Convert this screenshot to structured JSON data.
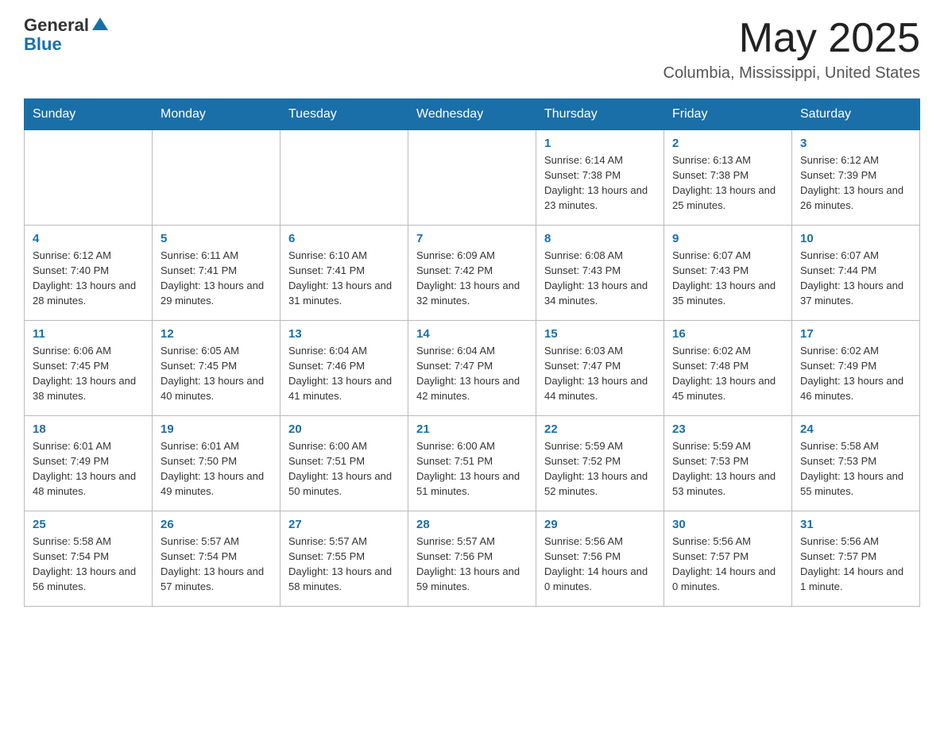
{
  "header": {
    "logo_general": "General",
    "logo_blue": "Blue",
    "month_title": "May 2025",
    "location": "Columbia, Mississippi, United States"
  },
  "weekdays": [
    "Sunday",
    "Monday",
    "Tuesday",
    "Wednesday",
    "Thursday",
    "Friday",
    "Saturday"
  ],
  "weeks": [
    [
      {
        "day": "",
        "info": ""
      },
      {
        "day": "",
        "info": ""
      },
      {
        "day": "",
        "info": ""
      },
      {
        "day": "",
        "info": ""
      },
      {
        "day": "1",
        "info": "Sunrise: 6:14 AM\nSunset: 7:38 PM\nDaylight: 13 hours and 23 minutes."
      },
      {
        "day": "2",
        "info": "Sunrise: 6:13 AM\nSunset: 7:38 PM\nDaylight: 13 hours and 25 minutes."
      },
      {
        "day": "3",
        "info": "Sunrise: 6:12 AM\nSunset: 7:39 PM\nDaylight: 13 hours and 26 minutes."
      }
    ],
    [
      {
        "day": "4",
        "info": "Sunrise: 6:12 AM\nSunset: 7:40 PM\nDaylight: 13 hours and 28 minutes."
      },
      {
        "day": "5",
        "info": "Sunrise: 6:11 AM\nSunset: 7:41 PM\nDaylight: 13 hours and 29 minutes."
      },
      {
        "day": "6",
        "info": "Sunrise: 6:10 AM\nSunset: 7:41 PM\nDaylight: 13 hours and 31 minutes."
      },
      {
        "day": "7",
        "info": "Sunrise: 6:09 AM\nSunset: 7:42 PM\nDaylight: 13 hours and 32 minutes."
      },
      {
        "day": "8",
        "info": "Sunrise: 6:08 AM\nSunset: 7:43 PM\nDaylight: 13 hours and 34 minutes."
      },
      {
        "day": "9",
        "info": "Sunrise: 6:07 AM\nSunset: 7:43 PM\nDaylight: 13 hours and 35 minutes."
      },
      {
        "day": "10",
        "info": "Sunrise: 6:07 AM\nSunset: 7:44 PM\nDaylight: 13 hours and 37 minutes."
      }
    ],
    [
      {
        "day": "11",
        "info": "Sunrise: 6:06 AM\nSunset: 7:45 PM\nDaylight: 13 hours and 38 minutes."
      },
      {
        "day": "12",
        "info": "Sunrise: 6:05 AM\nSunset: 7:45 PM\nDaylight: 13 hours and 40 minutes."
      },
      {
        "day": "13",
        "info": "Sunrise: 6:04 AM\nSunset: 7:46 PM\nDaylight: 13 hours and 41 minutes."
      },
      {
        "day": "14",
        "info": "Sunrise: 6:04 AM\nSunset: 7:47 PM\nDaylight: 13 hours and 42 minutes."
      },
      {
        "day": "15",
        "info": "Sunrise: 6:03 AM\nSunset: 7:47 PM\nDaylight: 13 hours and 44 minutes."
      },
      {
        "day": "16",
        "info": "Sunrise: 6:02 AM\nSunset: 7:48 PM\nDaylight: 13 hours and 45 minutes."
      },
      {
        "day": "17",
        "info": "Sunrise: 6:02 AM\nSunset: 7:49 PM\nDaylight: 13 hours and 46 minutes."
      }
    ],
    [
      {
        "day": "18",
        "info": "Sunrise: 6:01 AM\nSunset: 7:49 PM\nDaylight: 13 hours and 48 minutes."
      },
      {
        "day": "19",
        "info": "Sunrise: 6:01 AM\nSunset: 7:50 PM\nDaylight: 13 hours and 49 minutes."
      },
      {
        "day": "20",
        "info": "Sunrise: 6:00 AM\nSunset: 7:51 PM\nDaylight: 13 hours and 50 minutes."
      },
      {
        "day": "21",
        "info": "Sunrise: 6:00 AM\nSunset: 7:51 PM\nDaylight: 13 hours and 51 minutes."
      },
      {
        "day": "22",
        "info": "Sunrise: 5:59 AM\nSunset: 7:52 PM\nDaylight: 13 hours and 52 minutes."
      },
      {
        "day": "23",
        "info": "Sunrise: 5:59 AM\nSunset: 7:53 PM\nDaylight: 13 hours and 53 minutes."
      },
      {
        "day": "24",
        "info": "Sunrise: 5:58 AM\nSunset: 7:53 PM\nDaylight: 13 hours and 55 minutes."
      }
    ],
    [
      {
        "day": "25",
        "info": "Sunrise: 5:58 AM\nSunset: 7:54 PM\nDaylight: 13 hours and 56 minutes."
      },
      {
        "day": "26",
        "info": "Sunrise: 5:57 AM\nSunset: 7:54 PM\nDaylight: 13 hours and 57 minutes."
      },
      {
        "day": "27",
        "info": "Sunrise: 5:57 AM\nSunset: 7:55 PM\nDaylight: 13 hours and 58 minutes."
      },
      {
        "day": "28",
        "info": "Sunrise: 5:57 AM\nSunset: 7:56 PM\nDaylight: 13 hours and 59 minutes."
      },
      {
        "day": "29",
        "info": "Sunrise: 5:56 AM\nSunset: 7:56 PM\nDaylight: 14 hours and 0 minutes."
      },
      {
        "day": "30",
        "info": "Sunrise: 5:56 AM\nSunset: 7:57 PM\nDaylight: 14 hours and 0 minutes."
      },
      {
        "day": "31",
        "info": "Sunrise: 5:56 AM\nSunset: 7:57 PM\nDaylight: 14 hours and 1 minute."
      }
    ]
  ]
}
